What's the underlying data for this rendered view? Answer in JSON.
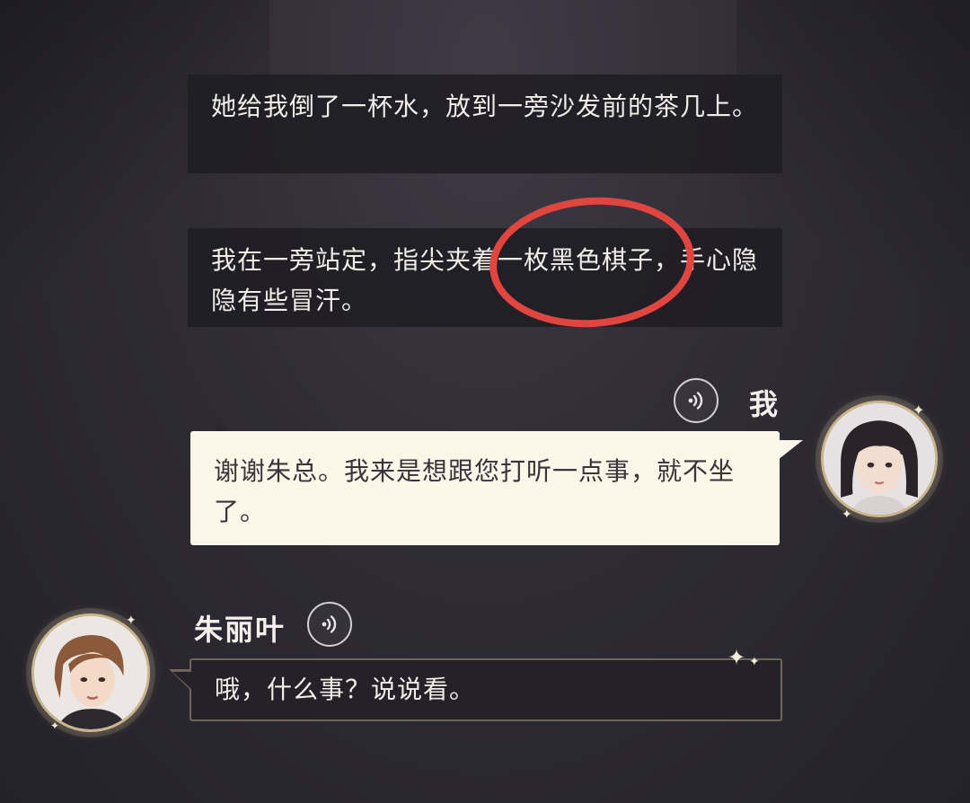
{
  "narrations": [
    {
      "text": "她给我倒了一杯水，放到一旁沙发前的茶几上。"
    },
    {
      "text": "我在一旁站定，指尖夹着一枚黑色棋子，手心隐隐有些冒汗。"
    }
  ],
  "dialogue_me": {
    "speaker": "我",
    "text": "谢谢朱总。我来是想跟您打听一点事，就不坐了。",
    "voice_icon": "voice-play-icon"
  },
  "dialogue_juliet": {
    "speaker": "朱丽叶",
    "text": "哦，什么事？说说看。",
    "voice_icon": "voice-play-icon"
  },
  "colors": {
    "highlight_ring": "#e0453f",
    "bubble_light": "#fbf6e8",
    "bubble_dark": "#242128",
    "avatar_border": "#c9b68e"
  }
}
